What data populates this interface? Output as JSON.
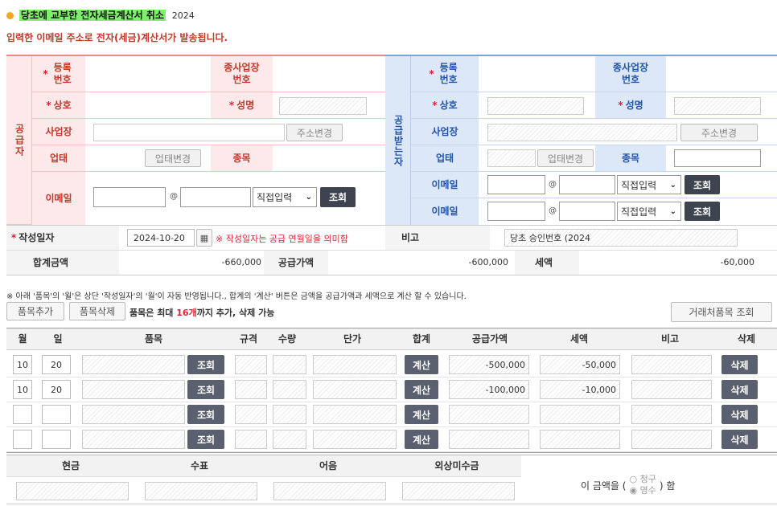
{
  "header": {
    "title": "당초에 교부한 전자세금계산서 취소",
    "title_suffix": "2024",
    "notice": "입력한 이메일 주소로 전자(세금)계산서가 발송됩니다."
  },
  "supplier": {
    "side_label": "공급자",
    "reg_no_label": "등록번호",
    "sub_biz_label": "종사업장번호",
    "company_label": "상호",
    "name_label": "성명",
    "address_label": "사업장",
    "address_btn": "주소변경",
    "biz_type_label": "업태",
    "biz_type_btn": "업태변경",
    "item_label": "종목",
    "email_label": "이메일",
    "email_at": "@",
    "email_select": "직접입력",
    "lookup_btn": "조회"
  },
  "receiver": {
    "side_label": "공급받는자",
    "reg_no_label": "등록번호",
    "sub_biz_label": "종사업장번호",
    "company_label": "상호",
    "name_label": "성명",
    "address_label": "사업장",
    "address_btn": "주소변경",
    "biz_type_label": "업태",
    "biz_type_btn": "업태변경",
    "item_label": "종목",
    "email1_label": "이메일",
    "email2_label": "이메일",
    "email_at": "@",
    "email_select": "직접입력",
    "lookup_btn": "조회"
  },
  "summary": {
    "date_label": "작성일자",
    "date_value": "2024-10-20",
    "date_note": "※ 작성일자는 공급 연월일을 의미함",
    "remark_label": "비고",
    "remark_value": "당초 승인번호 (2024",
    "total_label": "합계금액",
    "total_value": "-660,000",
    "supply_label": "공급가액",
    "supply_value": "-600,000",
    "tax_label": "세액",
    "tax_value": "-60,000"
  },
  "items_help": "※ 아래 '품목'의 '월'은 상단 '작성일자'의 '월'이 자동 반영됩니다., 합계의 '계산' 버튼은 금액을 공급가액과 세액으로 계산 할 수 있습니다.",
  "items_toolbar": {
    "add_btn": "품목추가",
    "delete_btn": "품목삭제",
    "limit_pre": "품목은 최대 ",
    "limit_num": "16개",
    "limit_post": "까지 추가, 삭제 가능",
    "partner_btn": "거래처품목 조회"
  },
  "items_table": {
    "headers": [
      "월",
      "일",
      "품목",
      "규격",
      "수량",
      "단가",
      "합계",
      "공급가액",
      "세액",
      "비고",
      "삭제"
    ],
    "lookup_btn": "조회",
    "calc_btn": "계산",
    "delete_btn": "삭제",
    "rows": [
      {
        "month": "10",
        "day": "20",
        "supply": "-500,000",
        "tax": "-50,000"
      },
      {
        "month": "10",
        "day": "20",
        "supply": "-100,000",
        "tax": "-10,000"
      },
      {
        "month": "",
        "day": "",
        "supply": "",
        "tax": ""
      },
      {
        "month": "",
        "day": "",
        "supply": "",
        "tax": ""
      }
    ]
  },
  "payment": {
    "headers": [
      "현금",
      "수표",
      "어음",
      "외상미수금"
    ],
    "amount_prefix": "이 금액을 (",
    "opt_claim": "청구",
    "opt_receipt": "영수",
    "amount_suffix": ") 함"
  },
  "colors": {
    "supplier_border": "#e88",
    "supplier_bg": "#fde9e9",
    "receiver_border": "#7aa3d8",
    "receiver_bg": "#dce7f8",
    "title_highlight": "#7ef06c",
    "dark_button": "#3d4450"
  }
}
